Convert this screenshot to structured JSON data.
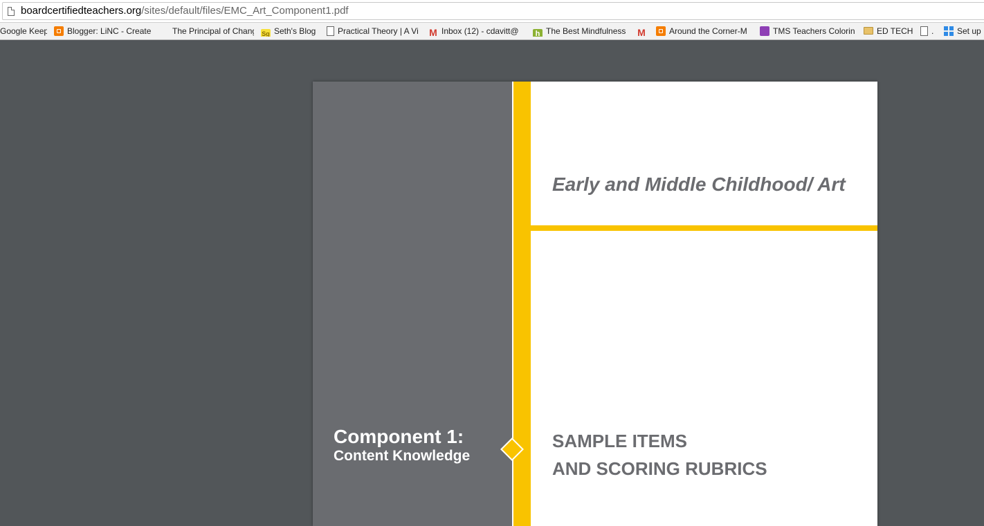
{
  "browser": {
    "url_host": "boardcertifiedteachers.org",
    "url_path": "/sites/default/files/EMC_Art_Component1.pdf",
    "bookmarks": [
      {
        "label": "Google Keep",
        "icon": "none"
      },
      {
        "label": "Blogger: LiNC - Create",
        "icon": "blogger-icon"
      },
      {
        "label": "The Principal of Chang",
        "icon": "none"
      },
      {
        "label": "Seth's Blog",
        "icon": "seth-icon"
      },
      {
        "label": "Practical Theory | A Vi",
        "icon": "page-icon"
      },
      {
        "label": "Inbox (12) - cdavitt@",
        "icon": "gmail-icon"
      },
      {
        "label": "The Best Mindfulness",
        "icon": "hh-icon"
      },
      {
        "label": "",
        "icon": "gmail-icon"
      },
      {
        "label": "Around the Corner-M",
        "icon": "blogger-icon"
      },
      {
        "label": "TMS Teachers Colorin",
        "icon": "tms-icon"
      },
      {
        "label": "ED TECH",
        "icon": "folder-icon"
      },
      {
        "label": ".",
        "icon": "page-icon"
      },
      {
        "label": "Set up",
        "icon": "windows-icon"
      }
    ]
  },
  "document": {
    "title": "Early and Middle Childhood/ Art",
    "component_line1": "Component 1:",
    "component_line2": "Content Knowledge",
    "sample_line1": "SAMPLE ITEMS",
    "sample_line2": "AND SCORING RUBRICS"
  },
  "colors": {
    "accent_yellow": "#f9c300",
    "band_grey": "#6a6c70",
    "viewer_background": "#525659"
  }
}
